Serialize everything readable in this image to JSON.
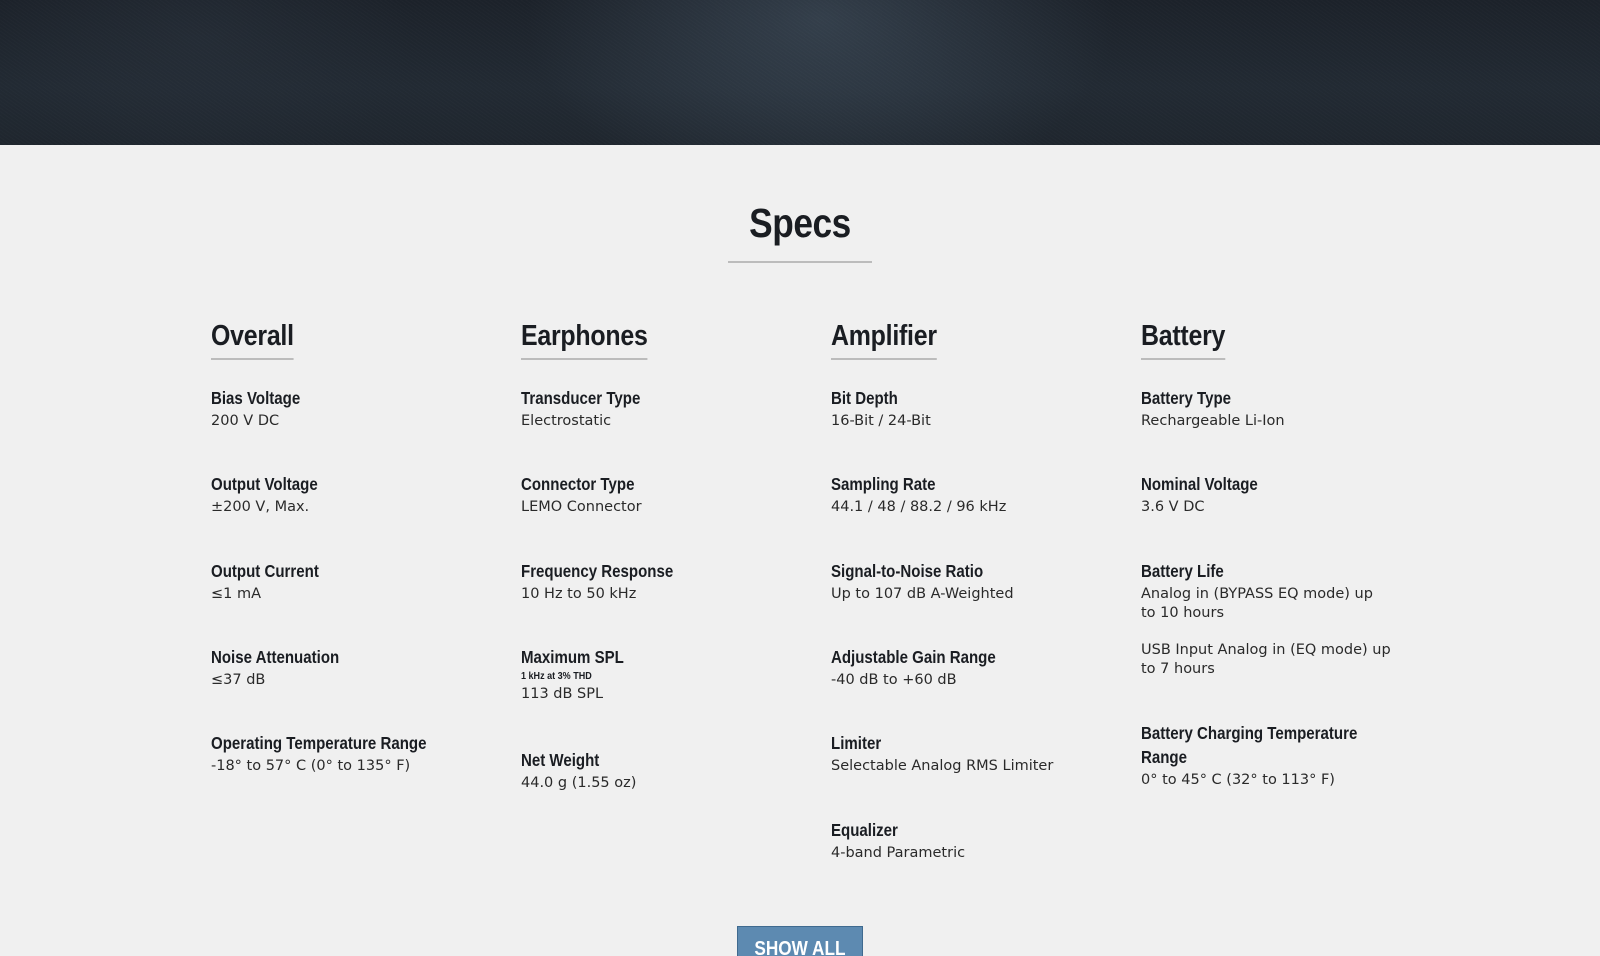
{
  "section_title": "Specs",
  "columns": [
    {
      "title": "Overall",
      "specs": [
        {
          "label": "Bias Voltage",
          "values": [
            "200 V DC"
          ]
        },
        {
          "label": "Output Voltage",
          "values": [
            "±200 V, Max."
          ]
        },
        {
          "label": "Output Current",
          "values": [
            "≤1 mA"
          ]
        },
        {
          "label": "Noise Attenuation",
          "values": [
            "≤37 dB"
          ]
        },
        {
          "label": "Operating Temperature Range",
          "values": [
            "-18° to 57° C (0° to 135° F)"
          ]
        }
      ]
    },
    {
      "title": "Earphones",
      "specs": [
        {
          "label": "Transducer Type",
          "values": [
            "Electrostatic"
          ]
        },
        {
          "label": "Connector Type",
          "values": [
            "LEMO Connector"
          ]
        },
        {
          "label": "Frequency Response",
          "values": [
            "10 Hz to 50 kHz"
          ]
        },
        {
          "label": "Maximum SPL",
          "note": "1 kHz at 3% THD",
          "values": [
            "113 dB SPL"
          ]
        },
        {
          "label": "Net Weight",
          "values": [
            "44.0 g (1.55 oz)"
          ]
        }
      ]
    },
    {
      "title": "Amplifier",
      "specs": [
        {
          "label": "Bit Depth",
          "values": [
            "16-Bit / 24-Bit"
          ]
        },
        {
          "label": "Sampling Rate",
          "values": [
            "44.1 / 48 / 88.2 / 96 kHz"
          ]
        },
        {
          "label": "Signal-to-Noise Ratio",
          "values": [
            "Up to 107 dB A-Weighted"
          ]
        },
        {
          "label": "Adjustable Gain Range",
          "values": [
            "-40 dB to +60 dB"
          ]
        },
        {
          "label": "Limiter",
          "values": [
            "Selectable Analog RMS Limiter"
          ]
        },
        {
          "label": "Equalizer",
          "values": [
            "4-band Parametric"
          ]
        }
      ]
    },
    {
      "title": "Battery",
      "specs": [
        {
          "label": "Battery Type",
          "values": [
            "Rechargeable Li-Ion"
          ]
        },
        {
          "label": "Nominal Voltage",
          "values": [
            "3.6 V DC"
          ]
        },
        {
          "label": "Battery Life",
          "values": [
            "Analog in (BYPASS EQ mode) up to 10 hours",
            "USB Input Analog in (EQ mode) up to 7 hours"
          ]
        },
        {
          "label": "Battery Charging Temperature Range",
          "values": [
            "0° to 45° C (32° to 113° F)"
          ]
        }
      ]
    }
  ],
  "show_all_label": "SHOW ALL"
}
